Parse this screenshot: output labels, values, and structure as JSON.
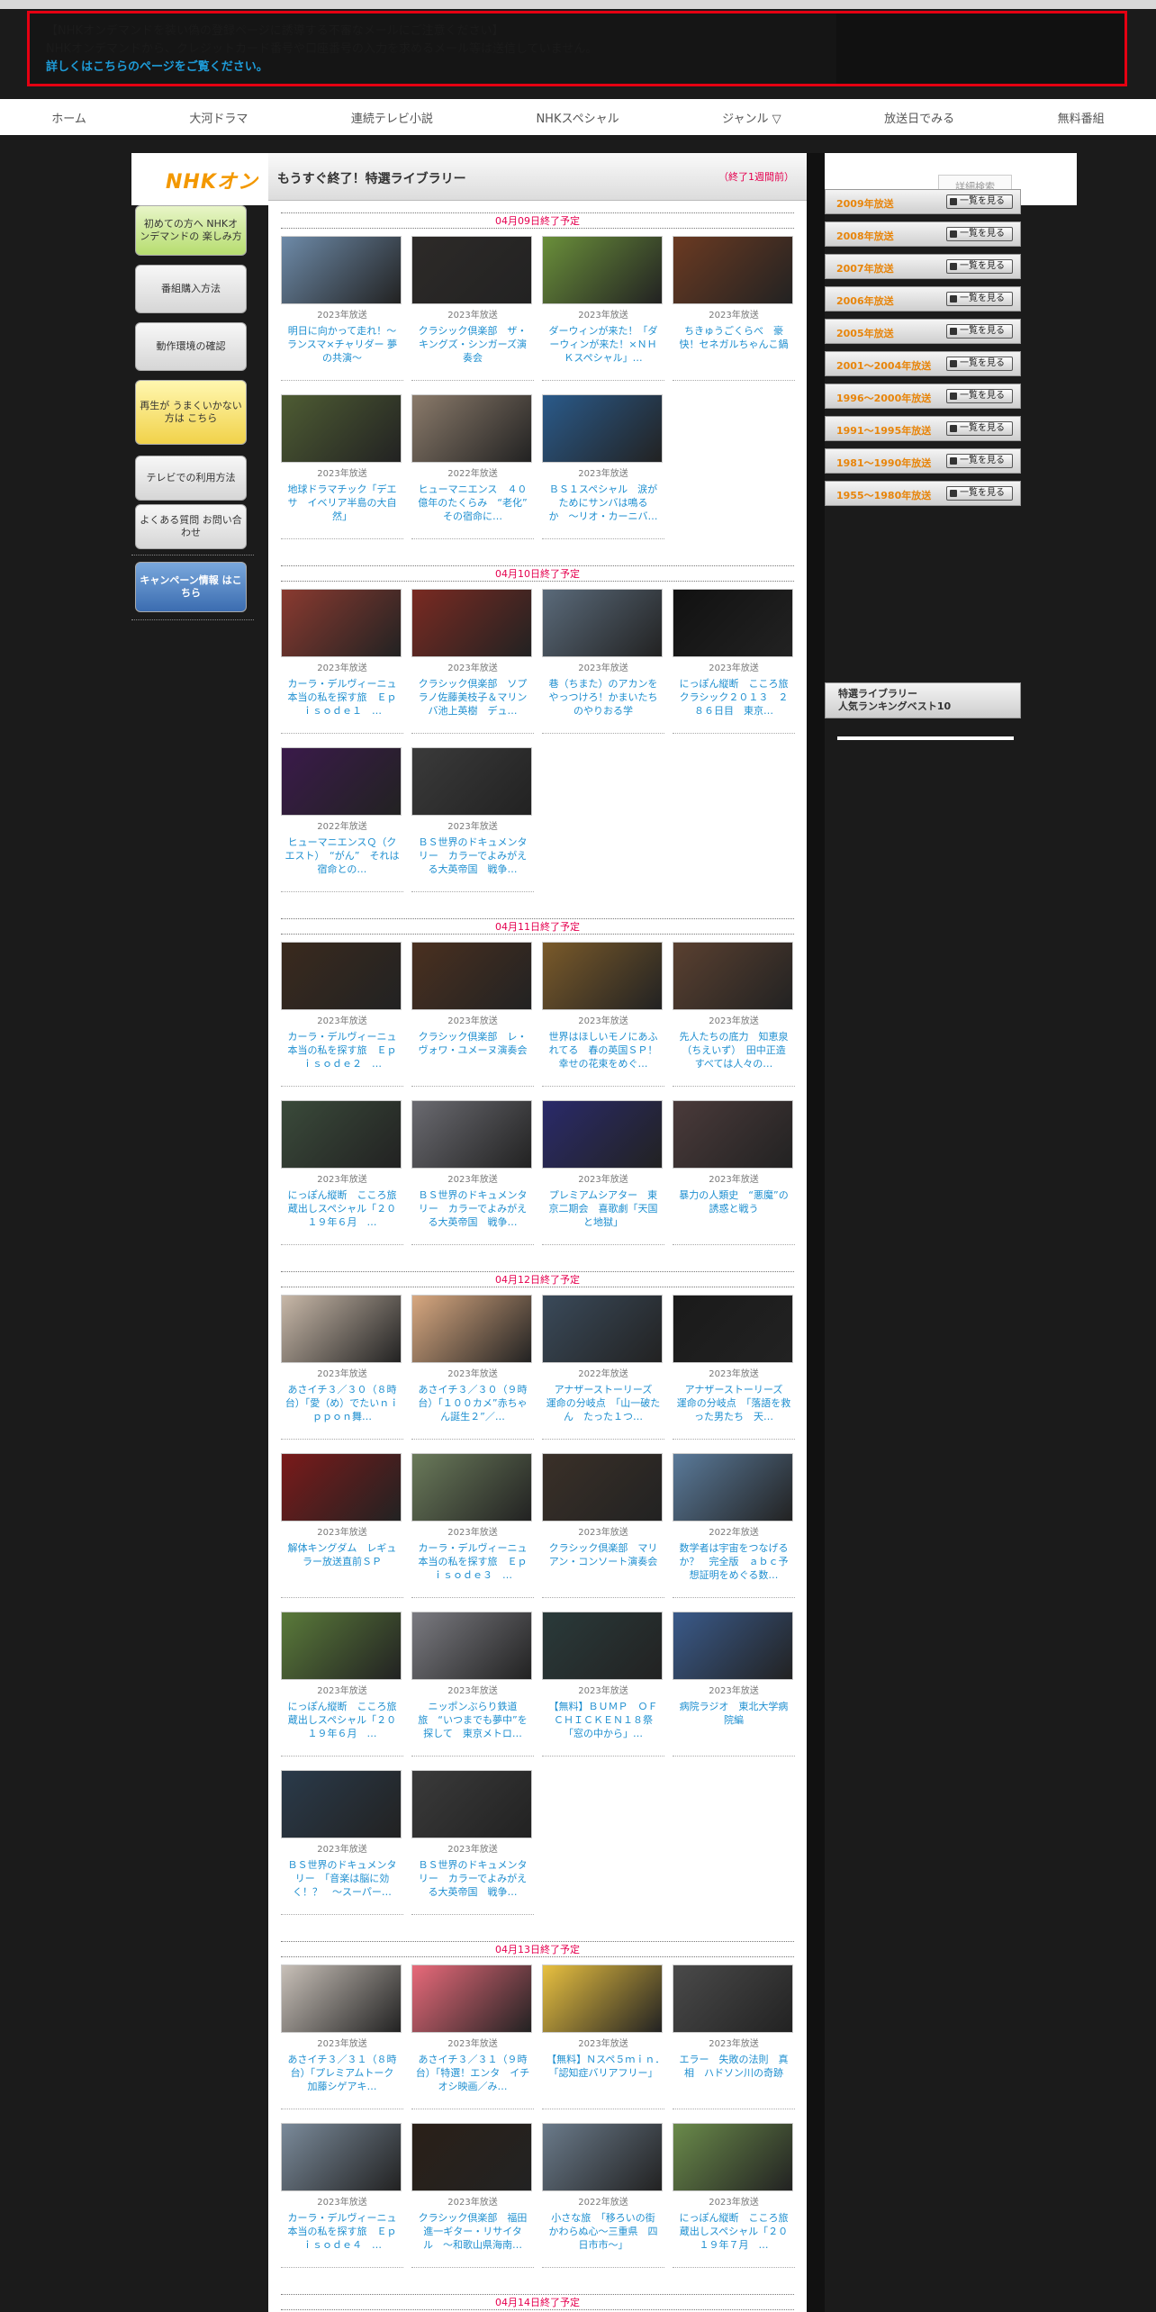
{
  "alert": {
    "line1": "【NHKオンデマンドを装い偽の登録ページに誘導する不審なメールにご注意ください】",
    "line2": "NHKオンデマンドから、クレジットカード番号や口座番号の入力を求めるメール等は送信していません。",
    "link": "詳しくはこちらのページをご覧ください。"
  },
  "nav": [
    "ホーム",
    "大河ドラマ",
    "連続テレビ小説",
    "NHKスペシャル",
    "ジャンル ▽",
    "放送日でみる",
    "無料番組"
  ],
  "header": {
    "logo": "NHKオン",
    "search_placeholder": "詳細検索"
  },
  "main": {
    "title": "もうすぐ終了！特選ライブラリー",
    "note": "（終了1週間前）"
  },
  "sidebar": {
    "btn1": "初めての方へ NHKオンデマンドの 楽しみ方",
    "btn2": "番組購入方法",
    "btn3": "動作環境の確認",
    "btn4": "再生が うまくいかない方は こちら",
    "btn5": "テレビでの利用方法",
    "btn6": "よくある質問 お問い合わせ",
    "btn7": "キャンペーン情報 はこちら"
  },
  "years": [
    {
      "label": "2009年放送",
      "view": "一覧を見る"
    },
    {
      "label": "2008年放送",
      "view": "一覧を見る"
    },
    {
      "label": "2007年放送",
      "view": "一覧を見る"
    },
    {
      "label": "2006年放送",
      "view": "一覧を見る"
    },
    {
      "label": "2005年放送",
      "view": "一覧を見る"
    },
    {
      "label": "2001〜2004年放送",
      "view": "一覧を見る"
    },
    {
      "label": "1996〜2000年放送",
      "view": "一覧を見る"
    },
    {
      "label": "1991〜1995年放送",
      "view": "一覧を見る"
    },
    {
      "label": "1981〜1990年放送",
      "view": "一覧を見る"
    },
    {
      "label": "1955〜1980年放送",
      "view": "一覧を見る"
    }
  ],
  "ranking": {
    "line1": "特選ライブラリー",
    "line2": "人気ランキングベスト10"
  },
  "sections": [
    {
      "date": "04月09日終了予定",
      "items": [
        {
          "year": "2023年放送",
          "title": "明日に向かって走れ！〜ランスマ×チャリダー 夢の共演〜",
          "color": "#6d8aa8"
        },
        {
          "year": "2023年放送",
          "title": "クラシック倶楽部　ザ・キングズ・シンガーズ演奏会",
          "color": "#2d2a28"
        },
        {
          "year": "2023年放送",
          "title": "ダーウィンが来た！「ダーウィンが来た！×ＮＨＫスペシャル」…",
          "color": "#6a8f3a"
        },
        {
          "year": "2023年放送",
          "title": "ちきゅうごくらべ　豪快！セネガルちゃんこ鍋",
          "color": "#6b3a22"
        },
        {
          "year": "2023年放送",
          "title": "地球ドラマチック「デエサ　イベリア半島の大自然」",
          "color": "#4e5c33"
        },
        {
          "year": "2022年放送",
          "title": "ヒューマニエンス　４０億年のたくらみ　“老化”　その宿命に…",
          "color": "#8a7a6a"
        },
        {
          "year": "2023年放送",
          "title": "ＢＳ１スペシャル　涙がためにサンバは鳴るか　〜リオ・カーニバ…",
          "color": "#2a5a8a"
        }
      ]
    },
    {
      "date": "04月10日終了予定",
      "items": [
        {
          "year": "2023年放送",
          "title": "カーラ・デルヴィーニュ 本当の私を探す旅　Ｅｐｉｓｏｄｅ１　…",
          "color": "#8a3a30"
        },
        {
          "year": "2023年放送",
          "title": "クラシック倶楽部　ソプラノ佐藤美枝子＆マリンバ池上英樹　デュ…",
          "color": "#7a2a22"
        },
        {
          "year": "2023年放送",
          "title": "巷（ちまた）のアカンをやっつけろ！かまいたちのやりおる学",
          "color": "#5a6a7a"
        },
        {
          "year": "2023年放送",
          "title": "にっぽん縦断　こころ旅　クラシック２０１３　２８６日目　東京…",
          "color": "#111111"
        },
        {
          "year": "2022年放送",
          "title": "ヒューマニエンスＱ（クエスト）　“がん”　それは宿命との…",
          "color": "#3a1a4a"
        },
        {
          "year": "2023年放送",
          "title": "ＢＳ世界のドキュメンタリー　カラーでよみがえる大英帝国　戦争…",
          "color": "#3a3a3a"
        }
      ]
    },
    {
      "date": "04月11日終了予定",
      "items": [
        {
          "year": "2023年放送",
          "title": "カーラ・デルヴィーニュ 本当の私を探す旅　Ｅｐｉｓｏｄｅ２　…",
          "color": "#3a2a1e"
        },
        {
          "year": "2023年放送",
          "title": "クラシック倶楽部　レ・ヴォワ・ユメーヌ演奏会",
          "color": "#4a3020"
        },
        {
          "year": "2023年放送",
          "title": "世界はほしいモノにあふれてる　春の英国ＳＰ！幸せの花束をめぐ…",
          "color": "#7a5a2a"
        },
        {
          "year": "2023年放送",
          "title": "先人たちの底力　知恵泉（ちえいず）　田中正造　すべては人々の…",
          "color": "#5a4030"
        },
        {
          "year": "2023年放送",
          "title": "にっぽん縦断　こころ旅　蔵出しスペシャル「２０１９年６月　…",
          "color": "#3a4a3a"
        },
        {
          "year": "2023年放送",
          "title": "ＢＳ世界のドキュメンタリー　カラーでよみがえる大英帝国　戦争…",
          "color": "#6a6a70"
        },
        {
          "year": "2023年放送",
          "title": "プレミアムシアター　東京二期会　喜歌劇「天国と地獄」",
          "color": "#2a2a6a"
        },
        {
          "year": "2023年放送",
          "title": "暴力の人類史　“悪魔”の誘惑と戦う",
          "color": "#4a3a3a"
        }
      ]
    },
    {
      "date": "04月12日終了予定",
      "items": [
        {
          "year": "2023年放送",
          "title": "あさイチ３／３０（８時台）「愛（め）でたいｎｉｐｐｏｎ舞…",
          "color": "#c8b8a8"
        },
        {
          "year": "2023年放送",
          "title": "あさイチ３／３０（９時台）「１００カメ”赤ちゃん誕生２”／…",
          "color": "#d8a880"
        },
        {
          "year": "2022年放送",
          "title": "アナザーストーリーズ　運命の分岐点　「山一破たん　たった１つ…",
          "color": "#3a4a5a"
        },
        {
          "year": "2023年放送",
          "title": "アナザーストーリーズ　運命の分岐点　「落語を救った男たち　天…",
          "color": "#1a1a1a"
        },
        {
          "year": "2023年放送",
          "title": "解体キングダム　レギュラー放送直前ＳＰ",
          "color": "#7a1a1a"
        },
        {
          "year": "2023年放送",
          "title": "カーラ・デルヴィーニュ 本当の私を探す旅　Ｅｐｉｓｏｄｅ３　…",
          "color": "#6a7a5a"
        },
        {
          "year": "2023年放送",
          "title": "クラシック倶楽部　マリアン・コンソート演奏会",
          "color": "#3a3028"
        },
        {
          "year": "2022年放送",
          "title": "数学者は宇宙をつなげるか？　完全版　ａｂｃ予想証明をめぐる数…",
          "color": "#5a7a9a"
        },
        {
          "year": "2023年放送",
          "title": "にっぽん縦断　こころ旅　蔵出しスペシャル「２０１９年６月　…",
          "color": "#5a7a3a"
        },
        {
          "year": "2023年放送",
          "title": "ニッポンぶらり鉄道旅　“いつまでも夢中”を探して　東京メトロ…",
          "color": "#7a7a80"
        },
        {
          "year": "2023年放送",
          "title": "【無料】ＢＵＭＰ　ＯＦ　ＣＨＩＣＫＥＮ１８祭　「窓の中から」…",
          "color": "#2a3a3a"
        },
        {
          "year": "2023年放送",
          "title": "病院ラジオ　東北大学病院編",
          "color": "#3a5a8a"
        },
        {
          "year": "2023年放送",
          "title": "ＢＳ世界のドキュメンタリー　「音楽は脳に効く！？　〜スーパー…",
          "color": "#2a3a4a"
        },
        {
          "year": "2023年放送",
          "title": "ＢＳ世界のドキュメンタリー　カラーでよみがえる大英帝国　戦争…",
          "color": "#3a3a3a"
        }
      ]
    },
    {
      "date": "04月13日終了予定",
      "items": [
        {
          "year": "2023年放送",
          "title": "あさイチ３／３１（８時台）「プレミアムトーク　加藤シゲアキ…",
          "color": "#c8c0b8"
        },
        {
          "year": "2023年放送",
          "title": "あさイチ３／３１（９時台）「特選！エンタ　イチオシ映画／み…",
          "color": "#e86a7a"
        },
        {
          "year": "2023年放送",
          "title": "【無料】Ｎスペ５ｍｉｎ．　「認知症バリアフリー」",
          "color": "#e8c040"
        },
        {
          "year": "2023年放送",
          "title": "エラー　失敗の法則　真相　ハドソン川の奇跡",
          "color": "#4a4a4a"
        },
        {
          "year": "2023年放送",
          "title": "カーラ・デルヴィーニュ 本当の私を探す旅　Ｅｐｉｓｏｄｅ４　…",
          "color": "#7a8a9a"
        },
        {
          "year": "2023年放送",
          "title": "クラシック倶楽部　福田進一ギター・リサイタル　〜和歌山県海南…",
          "color": "#2a2018"
        },
        {
          "year": "2022年放送",
          "title": "小さな旅　「移ろいの街　かわらぬ心〜三重県　四日市市〜」",
          "color": "#6a7a8a"
        },
        {
          "year": "2023年放送",
          "title": "にっぽん縦断　こころ旅　蔵出しスペシャル「２０１９年７月　…",
          "color": "#6a8a4a"
        }
      ]
    },
    {
      "date": "04月14日終了予定",
      "items": []
    }
  ]
}
